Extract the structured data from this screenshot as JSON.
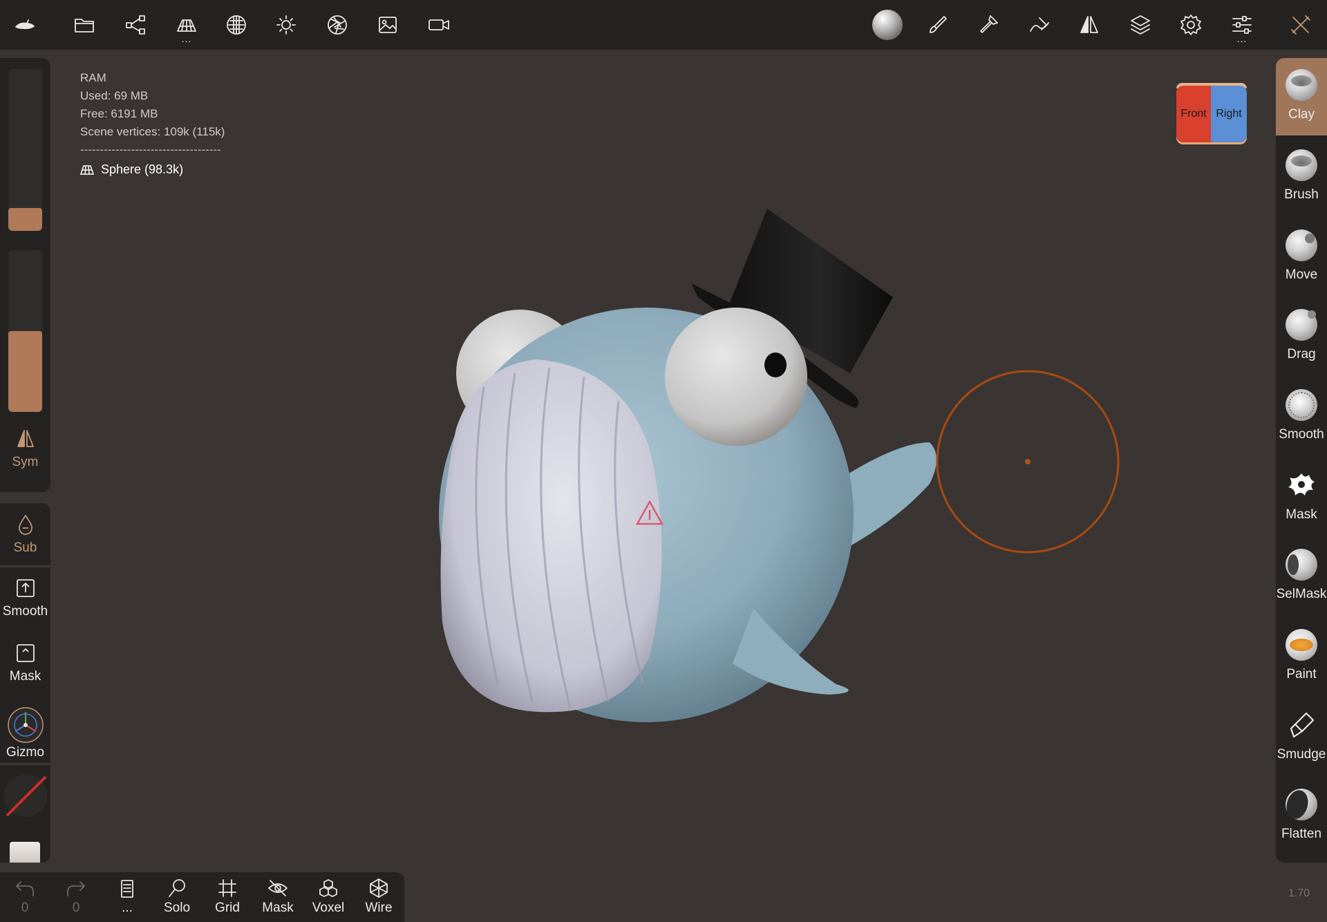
{
  "top_toolbar": {
    "left_icons": [
      "app-menu-icon",
      "folder-icon",
      "scene-graph-icon",
      "topology-icon",
      "material-sphere-icon",
      "light-icon",
      "camera-aperture-icon",
      "image-icon",
      "video-camera-icon"
    ],
    "topology_more": "...",
    "right_icons": [
      "material-preview-icon",
      "brush-settings-icon",
      "tools-icon",
      "stroke-icon",
      "symmetry-icon",
      "layers-icon",
      "settings-icon",
      "sliders-icon",
      "interface-tools-icon"
    ],
    "sliders_more": "..."
  },
  "stats": {
    "ram_label": "RAM",
    "used": "Used: 69 MB",
    "free": "Free: 6191 MB",
    "scene_vertices": "Scene vertices: 109k (115k)",
    "separator": "------------------------------------",
    "object_name": "Sphere (98.3k)"
  },
  "left_panel": {
    "radius_slider_value": 0.14,
    "intensity_slider_value": 0.5,
    "sym_label": "Sub",
    "sym_button_label": "Sym",
    "smooth_label": "Smooth",
    "mask_label": "Mask",
    "gizmo_label": "Gizmo"
  },
  "bottom_toolbar": {
    "undo_count": "0",
    "redo_count": "0",
    "more_label": "...",
    "solo_label": "Solo",
    "grid_label": "Grid",
    "mask_label": "Mask",
    "voxel_label": "Voxel",
    "wire_label": "Wire"
  },
  "tools": [
    {
      "label": "Clay",
      "active": true
    },
    {
      "label": "Brush",
      "active": false
    },
    {
      "label": "Move",
      "active": false
    },
    {
      "label": "Drag",
      "active": false
    },
    {
      "label": "Smooth",
      "active": false
    },
    {
      "label": "Mask",
      "active": false
    },
    {
      "label": "SelMask",
      "active": false
    },
    {
      "label": "Paint",
      "active": false
    },
    {
      "label": "Smudge",
      "active": false
    },
    {
      "label": "Flatten",
      "active": false
    }
  ],
  "view_cube": {
    "front": "Front",
    "right": "Right"
  },
  "version": "1.70",
  "colors": {
    "accent": "#c39673",
    "active_tool_bg": "#a0765a",
    "viewport_bg": "#3a3532",
    "panel_bg": "#242322",
    "brush_cursor": "#d2651f"
  }
}
